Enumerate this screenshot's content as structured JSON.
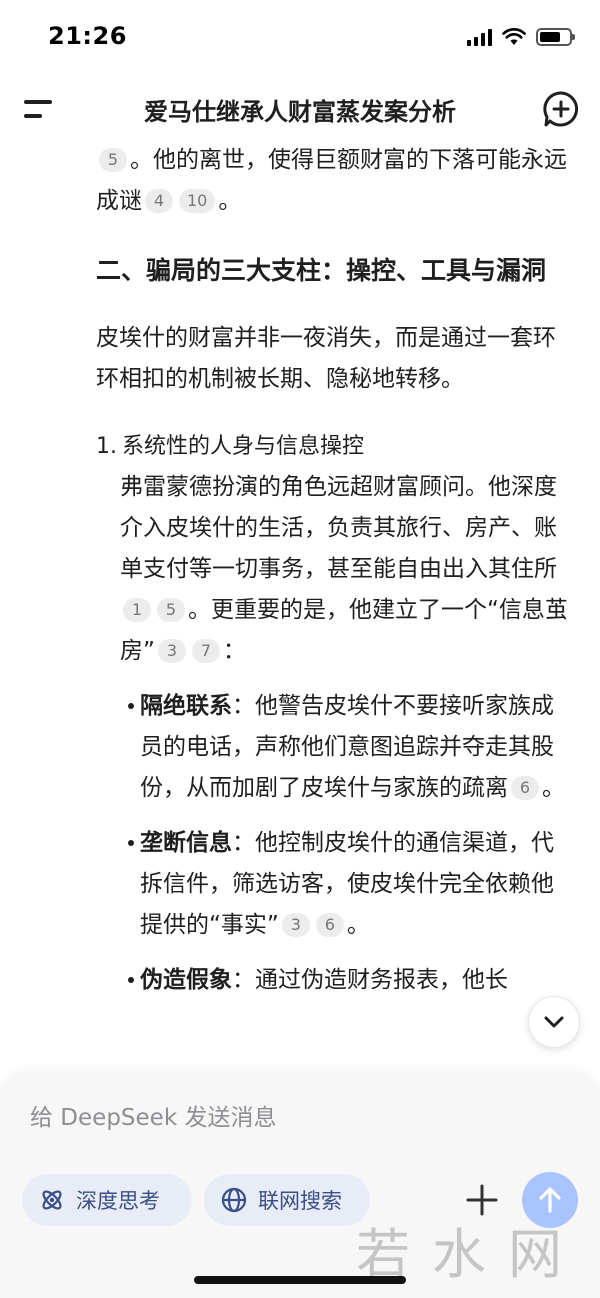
{
  "status_bar": {
    "time": "21:26"
  },
  "header": {
    "title": "爱马仕继承人财富蒸发案分析"
  },
  "content": {
    "intro": {
      "cite_a": "5",
      "text_a": "。他的离世，使得巨额财富的下落可能永远成谜",
      "cite_b": "4",
      "cite_c": "10",
      "text_b": "。"
    },
    "section_heading": "二、骗局的三大支柱：操控、工具与漏洞",
    "section_para": "皮埃什的财富并非一夜消失，而是通过一套环环相扣的机制被长期、隐秘地转移。",
    "list_item": {
      "number": "1.",
      "title": "系统性的人身与信息操控",
      "body_a": "弗雷蒙德扮演的角色远超财富顾问。他深度介入皮埃什的生活，负责其旅行、房产、账单支付等一切事务，甚至能自由出入其住所",
      "cite_a": "1",
      "cite_b": "5",
      "body_b": "。更重要的是，他建立了一个“信息茧房”",
      "cite_c": "3",
      "cite_d": "7",
      "body_c": "："
    },
    "bullets": [
      {
        "key": "隔绝联系",
        "text": "：他警告皮埃什不要接听家族成员的电话，声称他们意图追踪并夺走其股份，从而加剧了皮埃什与家族的疏离",
        "cite_a": "6",
        "tail": "。"
      },
      {
        "key": "垄断信息",
        "text": "：他控制皮埃什的通信渠道，代拆信件，筛选访客，使皮埃什完全依赖他提供的“事实”",
        "cite_a": "3",
        "cite_b": "6",
        "tail": "。"
      },
      {
        "key": "伪造假象",
        "text": "：通过伪造财务报表，他长"
      }
    ]
  },
  "composer": {
    "placeholder": "给 DeepSeek 发送消息",
    "deep_think_label": "深度思考",
    "web_search_label": "联网搜索"
  },
  "watermark": "若水网"
}
